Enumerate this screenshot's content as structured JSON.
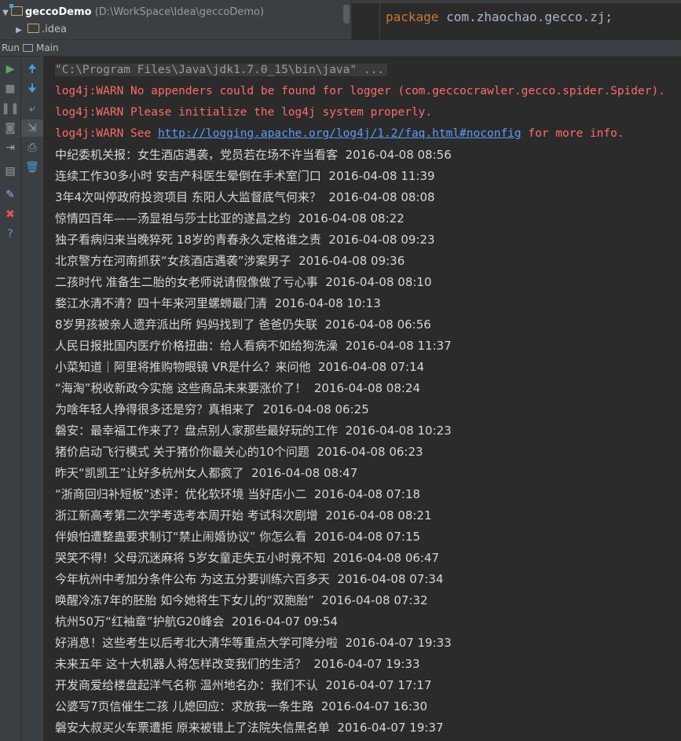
{
  "project": {
    "module_name": "geccoDemo",
    "module_path": "(D:\\WorkSpace\\Idea\\geccoDemo)",
    "child_folder": ".idea"
  },
  "editor": {
    "keyword": "package",
    "package_name": "com.zhaochao.gecco.zj;"
  },
  "run_panel": {
    "label": "Run",
    "tab": "Main"
  },
  "toolbar_left": [
    {
      "name": "run-icon",
      "glyph": "▶",
      "color": "#59a869"
    },
    {
      "name": "stop-icon",
      "glyph": "■",
      "color": "#7a7d80"
    },
    {
      "name": "pause-icon",
      "glyph": "❚❚",
      "color": "#7a7d80"
    },
    {
      "name": "camera-icon",
      "glyph": "◙",
      "color": "#7a7d80"
    },
    {
      "name": "exit-icon",
      "glyph": "⇥",
      "color": "#9aa7b0"
    },
    {
      "name": "layout-icon",
      "glyph": "▤",
      "color": "#9aa7b0"
    },
    {
      "name": "pin-icon",
      "glyph": "✎",
      "color": "#b99bf8"
    },
    {
      "name": "close-icon",
      "glyph": "✖",
      "color": "#e05555"
    },
    {
      "name": "help-icon",
      "glyph": "?",
      "color": "#4a9cd6"
    }
  ],
  "toolbar_right": [
    {
      "name": "up-arrow-icon",
      "glyph": "🠉",
      "color": "#4a9cd6"
    },
    {
      "name": "down-arrow-icon",
      "glyph": "🠋",
      "color": "#4a9cd6"
    },
    {
      "name": "soft-wrap-icon",
      "glyph": "⤶",
      "color": "#9aa7b0"
    },
    {
      "name": "scroll-to-end-icon",
      "glyph": "⇲",
      "color": "#9aa7b0"
    },
    {
      "name": "print-icon",
      "glyph": "⎙",
      "color": "#9aa7b0"
    },
    {
      "name": "trash-icon",
      "glyph": "🗑",
      "color": "#4a9cd6"
    }
  ],
  "console": {
    "command": "\"C:\\Program Files\\Java\\jdk1.7.0_15\\bin\\java\" ...",
    "warnings": [
      "log4j:WARN No appenders could be found for logger (com.geccocrawler.gecco.spider.Spider).",
      "log4j:WARN Please initialize the log4j system properly."
    ],
    "warn_see_prefix": "log4j:WARN See ",
    "warn_link": "http://logging.apache.org/log4j/1.2/faq.html#noconfig",
    "warn_see_suffix": " for more info.",
    "news": [
      {
        "title": "中纪委机关报：女生酒店遇袭，党员若在场不许当看客",
        "time": "2016-04-08 08:56"
      },
      {
        "title": "连续工作30多小时 安吉产科医生晕倒在手术室门口",
        "time": "2016-04-08 11:39"
      },
      {
        "title": "3年4次叫停政府投资项目 东阳人大监督底气何来？",
        "time": "2016-04-08 08:08"
      },
      {
        "title": "惊情四百年——汤显祖与莎士比亚的遂昌之约",
        "time": "2016-04-08 08:22"
      },
      {
        "title": "独子看病归来当晚猝死 18岁的青春永久定格谁之责",
        "time": "2016-04-08 09:23"
      },
      {
        "title": "北京警方在河南抓获“女孩酒店遇袭”涉案男子",
        "time": "2016-04-08 09:36"
      },
      {
        "title": "二孩时代 准备生二胎的女老师说请假像做了亏心事",
        "time": "2016-04-08 08:10"
      },
      {
        "title": "婺江水清不清？四十年来河里螺蛳最门清",
        "time": "2016-04-08 10:13"
      },
      {
        "title": "8岁男孩被亲人遗弃派出所 妈妈找到了 爸爸仍失联",
        "time": "2016-04-08 06:56"
      },
      {
        "title": "人民日报批国内医疗价格扭曲：给人看病不如给狗洗澡",
        "time": "2016-04-08 11:37"
      },
      {
        "title": "小菜知道｜阿里将推购物眼镜 VR是什么？来问他",
        "time": "2016-04-08 07:14"
      },
      {
        "title": "“海淘”税收新政今实施 这些商品未来要涨价了！",
        "time": "2016-04-08 08:24"
      },
      {
        "title": "为啥年轻人挣得很多还是穷？真相来了",
        "time": "2016-04-08 06:25"
      },
      {
        "title": "磐安：最幸福工作来了？盘点别人家那些最好玩的工作",
        "time": "2016-04-08 10:23"
      },
      {
        "title": "猪价启动飞行模式 关于猪价你最关心的10个问题",
        "time": "2016-04-08 06:23"
      },
      {
        "title": "昨天“凯凯王”让好多杭州女人都疯了",
        "time": "2016-04-08 08:47"
      },
      {
        "title": "“浙商回归补短板”述评：优化软环境 当好店小二",
        "time": "2016-04-08 07:18"
      },
      {
        "title": "浙江新高考第二次学考选考本周开始 考试科次剧增",
        "time": "2016-04-08 08:21"
      },
      {
        "title": "伴娘怕遭整蛊要求制订“禁止闹婚协议” 你怎么看",
        "time": "2016-04-08 07:15"
      },
      {
        "title": "哭笑不得！父母沉迷麻将 5岁女童走失五小时竟不知",
        "time": "2016-04-08 06:47"
      },
      {
        "title": "今年杭州中考加分条件公布 为这五分要训练六百多天",
        "time": "2016-04-08 07:34"
      },
      {
        "title": "唤醒冷冻7年的胚胎 如今她将生下女儿的“双胞胎”",
        "time": "2016-04-08 07:32"
      },
      {
        "title": "杭州50万“红袖章”护航G20峰会",
        "time": "2016-04-07 09:54"
      },
      {
        "title": "好消息！这些考生以后考北大清华等重点大学可降分啦",
        "time": "2016-04-07 19:33"
      },
      {
        "title": "未来五年 这十大机器人将怎样改变我们的生活？",
        "time": "2016-04-07 19:33"
      },
      {
        "title": "开发商爱给楼盘起洋气名称 温州地名办：我们不认",
        "time": "2016-04-07 17:17"
      },
      {
        "title": "公婆写7页信催生二孩 儿媳回应：求放我一条生路",
        "time": "2016-04-07 16:30"
      },
      {
        "title": "磐安大叔买火车票遭拒 原来被错上了法院失信黑名单",
        "time": "2016-04-07 19:37"
      }
    ]
  }
}
